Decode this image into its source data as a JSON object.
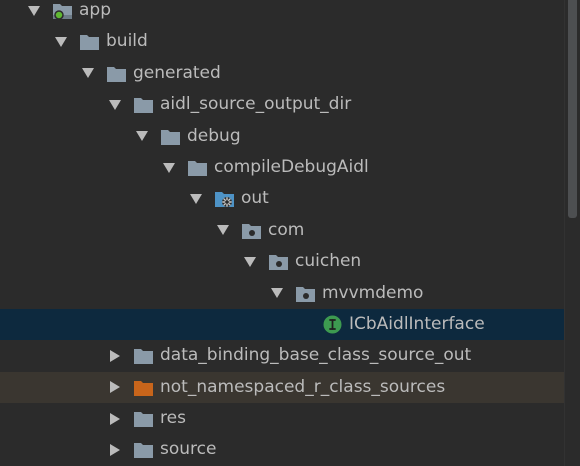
{
  "colors": {
    "background": "#2b2b2b",
    "text": "#bbbbbb",
    "folder": "#8a9aa8",
    "source_folder": "#4e93c6",
    "excluded_folder": "#c8651b",
    "selected_row": "#0d293e",
    "excluded_row": "#3a3630",
    "interface_badge": "#3d9a50",
    "module_badge": "#5fb832"
  },
  "tree": {
    "rows": [
      {
        "label": "app",
        "level": 0,
        "expanded": true,
        "icon": "module-folder-icon"
      },
      {
        "label": "build",
        "level": 1,
        "expanded": true,
        "icon": "folder-icon"
      },
      {
        "label": "generated",
        "level": 2,
        "expanded": true,
        "icon": "folder-icon"
      },
      {
        "label": "aidl_source_output_dir",
        "level": 3,
        "expanded": true,
        "icon": "folder-icon"
      },
      {
        "label": "debug",
        "level": 4,
        "expanded": true,
        "icon": "folder-icon"
      },
      {
        "label": "compileDebugAidl",
        "level": 5,
        "expanded": true,
        "icon": "folder-icon"
      },
      {
        "label": "out",
        "level": 6,
        "expanded": true,
        "icon": "generated-source-folder-icon"
      },
      {
        "label": "com",
        "level": 7,
        "expanded": true,
        "icon": "package-icon"
      },
      {
        "label": "cuichen",
        "level": 8,
        "expanded": true,
        "icon": "package-icon"
      },
      {
        "label": "mvvmdemo",
        "level": 9,
        "expanded": true,
        "icon": "package-icon"
      },
      {
        "label": "ICbAidlInterface",
        "level": 10,
        "leaf": true,
        "selected": true,
        "icon": "interface-icon"
      },
      {
        "label": "data_binding_base_class_source_out",
        "level": 3,
        "expanded": false,
        "icon": "folder-icon"
      },
      {
        "label": "not_namespaced_r_class_sources",
        "level": 3,
        "expanded": false,
        "excluded": true,
        "icon": "excluded-folder-icon"
      },
      {
        "label": "res",
        "level": 3,
        "expanded": false,
        "icon": "folder-icon"
      },
      {
        "label": "source",
        "level": 3,
        "expanded": false,
        "icon": "folder-icon"
      }
    ]
  }
}
